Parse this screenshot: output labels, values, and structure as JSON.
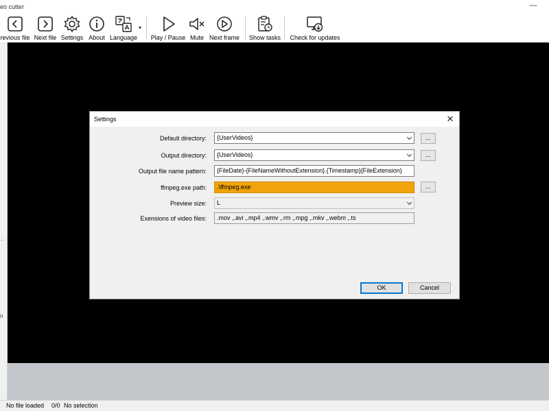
{
  "window": {
    "title": "eo cutter",
    "minimize_glyph": "—"
  },
  "toolbar": {
    "buttons": [
      {
        "label": "revious file",
        "icon": "chevron-left-icon"
      },
      {
        "label": "Next file",
        "icon": "chevron-right-icon"
      },
      {
        "label": "Settings",
        "icon": "gear-icon"
      },
      {
        "label": "About",
        "icon": "info-icon"
      },
      {
        "label": "Language",
        "icon": "translate-icon"
      },
      {
        "label": "Play / Pause",
        "icon": "play-icon"
      },
      {
        "label": "Mute",
        "icon": "mute-icon"
      },
      {
        "label": "Next frame",
        "icon": "next-frame-icon"
      },
      {
        "label": "Show tasks",
        "icon": "clipboard-clock-icon"
      },
      {
        "label": "Check for updates",
        "icon": "monitor-download-icon"
      }
    ],
    "language_dropdown_glyph": "▾"
  },
  "left_strip": {
    "mark1": "..",
    "mark2": "n"
  },
  "settings_dialog": {
    "title": "Settings",
    "close_glyph": "✕",
    "rows": [
      {
        "label": "Default directory:",
        "value": "{UserVideos}"
      },
      {
        "label": "Output directory:",
        "value": "{UserVideos}"
      },
      {
        "label": "Output file name pattern:",
        "value": "{FileDate}-{FileNameWithoutExtension}.{Timestamp}{FileExtension}"
      },
      {
        "label": "ffmpeg.exe path:",
        "value": ".\\ffmpeg.exe"
      },
      {
        "label": "Preview size:",
        "value": "L"
      },
      {
        "label": "Exensions of video files:",
        "value": ".mov ,.avi ,.mp4 ,.wmv ,.rm ,.mpg ,.mkv ,.webm ,.ts"
      }
    ],
    "browse_label": "...",
    "ok_label": "OK",
    "cancel_label": "Cancel"
  },
  "status_bar": {
    "file_status": "No file loaded",
    "frame_count": "0/0",
    "selection": "No selection"
  },
  "colors": {
    "highlight": "#f0a30a",
    "video_bg": "#000000",
    "accent": "#0078d7"
  }
}
